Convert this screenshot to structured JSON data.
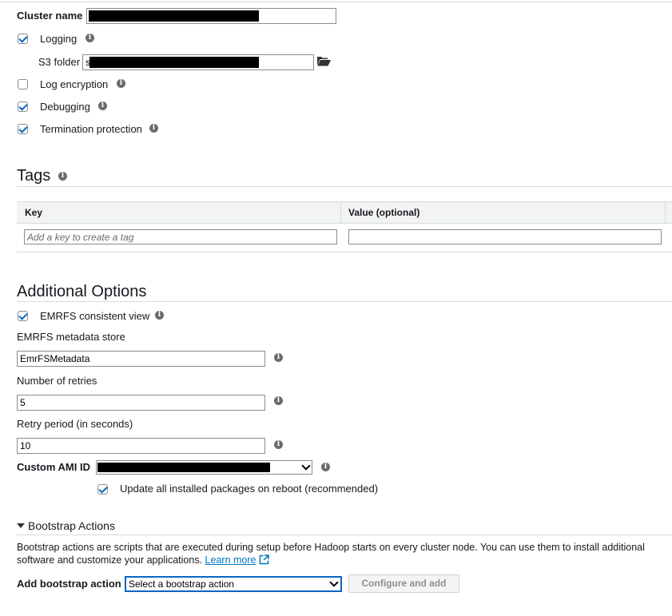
{
  "cluster": {
    "name_label": "Cluster name",
    "logging_label": "Logging",
    "s3_folder_label": "S3 folder",
    "s3_folder_prefix": "s",
    "log_encryption_label": "Log encryption",
    "debugging_label": "Debugging",
    "termination_protection_label": "Termination protection",
    "logging_checked": true,
    "log_encryption_checked": false,
    "debugging_checked": true,
    "termination_protection_checked": true
  },
  "tags": {
    "title": "Tags",
    "col_key": "Key",
    "col_value": "Value (optional)",
    "key_placeholder": "Add a key to create a tag",
    "value_value": ""
  },
  "additional": {
    "title": "Additional Options",
    "emrfs_consistent_label": "EMRFS consistent view",
    "emrfs_consistent_checked": true,
    "metadata_store_label": "EMRFS metadata store",
    "metadata_store_value": "EmrFSMetadata",
    "retries_label": "Number of retries",
    "retries_value": "5",
    "retry_period_label": "Retry period (in seconds)",
    "retry_period_value": "10",
    "ami_label": "Custom AMI ID",
    "update_packages_label": "Update all installed packages on reboot (recommended)",
    "update_packages_checked": true
  },
  "bootstrap": {
    "title": "Bootstrap Actions",
    "description": "Bootstrap actions are scripts that are executed during setup before Hadoop starts on every cluster node. You can use them to install additional software and customize your applications.",
    "learn_more": "Learn more",
    "add_label": "Add bootstrap action",
    "select_value": "Select a bootstrap action",
    "configure_button": "Configure and add"
  },
  "icons": {
    "info": "info-icon",
    "folder": "folder-open-icon",
    "external": "external-link-icon",
    "caret": "caret-down-icon"
  },
  "colors": {
    "accent": "#0a66c2",
    "link": "#0073bb",
    "border": "#d5dbdb"
  }
}
